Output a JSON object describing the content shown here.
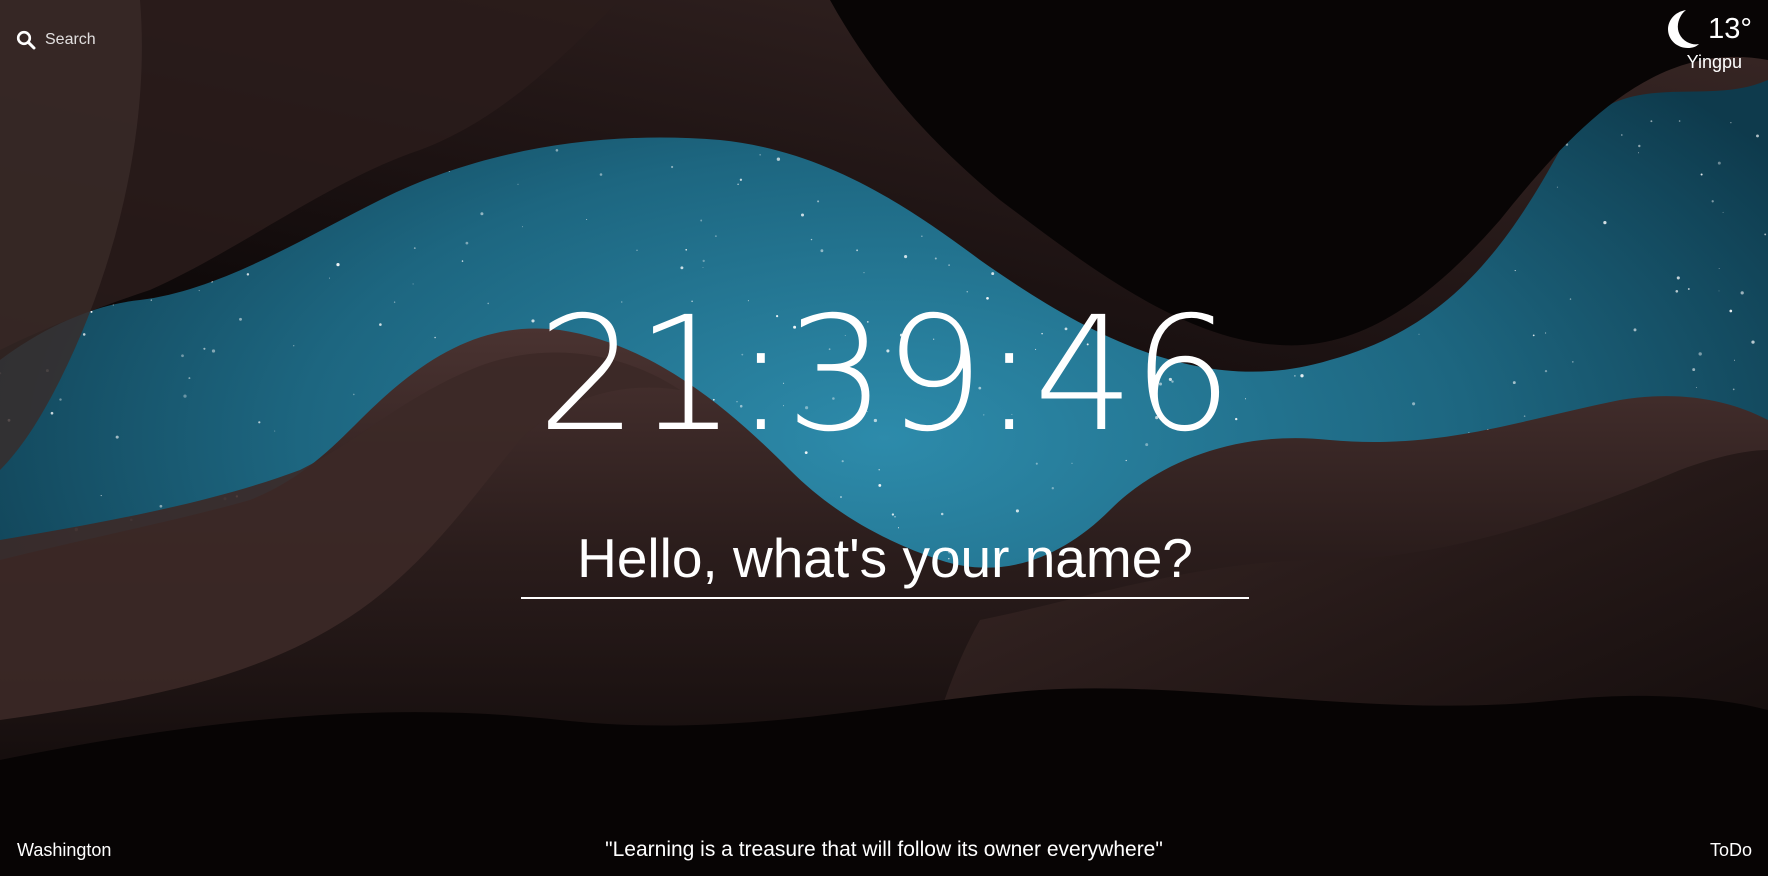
{
  "search": {
    "placeholder": "Search",
    "icon": "search-icon"
  },
  "weather": {
    "icon": "moon-icon",
    "temperature": "13°",
    "location": "Yingpu"
  },
  "clock": {
    "time": "21:39:46"
  },
  "focus": {
    "prompt": "Hello, what's your name?"
  },
  "footer": {
    "links_label": "Washington",
    "quote": "\"Learning is a treasure that will follow its owner everywhere\"",
    "todo_label": "ToDo"
  },
  "colors": {
    "sky": "#1f6e8c",
    "rock": "#2a1b1a",
    "text": "#ffffff"
  }
}
